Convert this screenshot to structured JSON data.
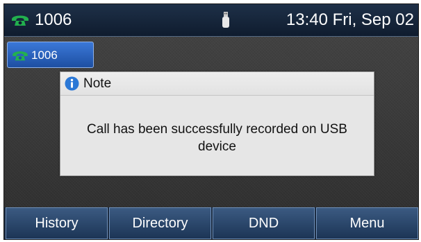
{
  "status_bar": {
    "account": "1006",
    "phone_icon": "phone-handset-icon",
    "usb_icon": "usb-icon",
    "datetime": "13:40 Fri, Sep 02"
  },
  "line_key": {
    "label": "1006",
    "icon": "phone-handset-icon",
    "color": "#2a63c0"
  },
  "note_dialog": {
    "title": "Note",
    "icon": "info-icon",
    "message": "Call has been successfully recorded on USB device"
  },
  "softkeys": [
    {
      "label": "History"
    },
    {
      "label": "Directory"
    },
    {
      "label": "DND"
    },
    {
      "label": "Menu"
    }
  ],
  "colors": {
    "status_bar": "#16253a",
    "phone_icon_green": "#1fa84a",
    "info_blue": "#2b78d6"
  }
}
